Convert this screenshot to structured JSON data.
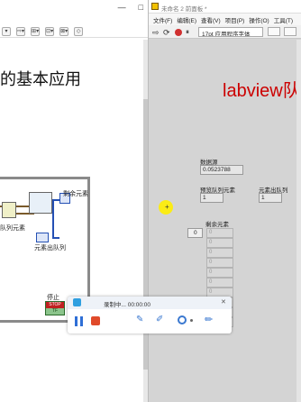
{
  "left_window": {
    "title_buttons": [
      "—",
      "□"
    ],
    "toolbar_items": [
      "▾",
      "⇨▾",
      "⊞▾",
      "⊡▾",
      "⊠▾",
      "◇"
    ],
    "heading": "的基本应用",
    "diagram": {
      "label_dequeue_element": "剩余元素",
      "label_queue_element": "队列元素",
      "label_element_out": "元素出队列",
      "label_stop": "停止",
      "stop_terminal": "STOP",
      "stop_tf": "TF"
    }
  },
  "right_window": {
    "title": "未命名 2 前面板 *",
    "menu": [
      "文件(F)",
      "编辑(E)",
      "查看(V)",
      "项目(P)",
      "操作(O)",
      "工具(T)"
    ],
    "toolbar_font": "17pt 应用程序字体",
    "heading": "labview队",
    "controls": {
      "data_source_label": "数据源",
      "data_source_value": "0.0523788",
      "preview_label": "预览队列元素",
      "preview_value": "1",
      "dequeue_label": "元素出队列",
      "dequeue_value": "1",
      "remaining_label": "剩余元素",
      "remaining_index": "0",
      "remaining_values": [
        "0",
        "0",
        "0",
        "0",
        "0",
        "0",
        "0",
        "0",
        "0",
        "0"
      ]
    }
  },
  "recorder": {
    "status": "录制中... 00:00:00",
    "close": "✕"
  },
  "colors": {
    "panel_bg": "#d4d4d4",
    "accent_heading": "#cc0000",
    "pause_blue": "#2f6fd6",
    "stop_red": "#e04a2a",
    "cursor_yellow": "#ffee00"
  }
}
